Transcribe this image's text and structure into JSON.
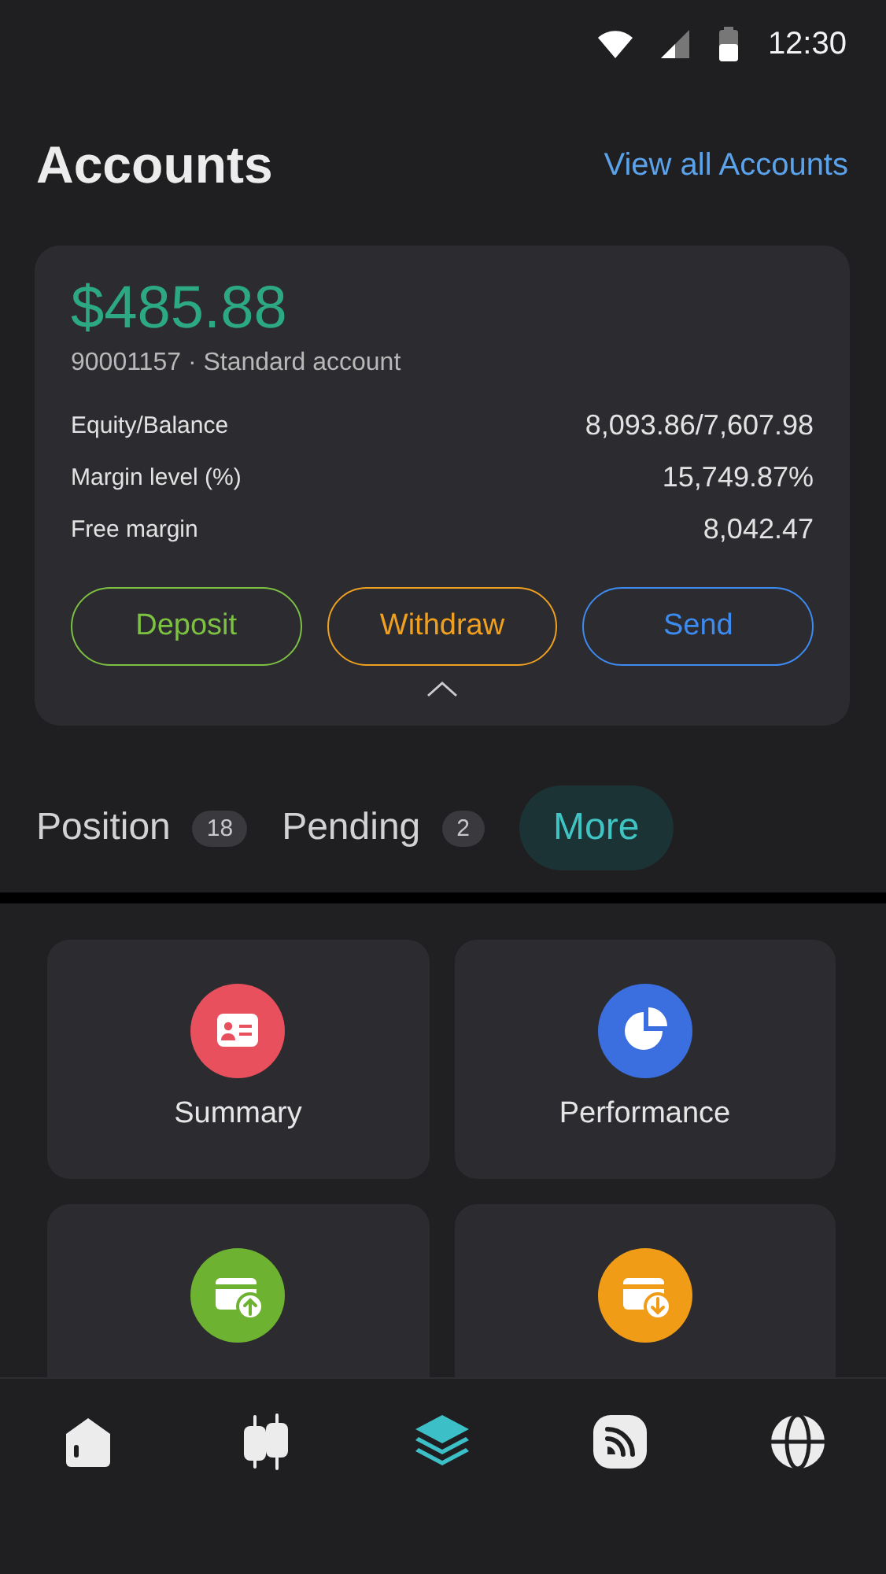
{
  "status_bar": {
    "time": "12:30"
  },
  "header": {
    "title": "Accounts",
    "link": "View all Accounts"
  },
  "account": {
    "balance": "$485.88",
    "subtitle": "90001157 · Standard account",
    "stats": [
      {
        "label": "Equity/Balance",
        "value": "8,093.86/7,607.98"
      },
      {
        "label": "Margin level (%)",
        "value": "15,749.87%"
      },
      {
        "label": "Free margin",
        "value": "8,042.47"
      }
    ],
    "buttons": [
      {
        "label": "Deposit",
        "color": "#7cc142"
      },
      {
        "label": "Withdraw",
        "color": "#f0a020"
      },
      {
        "label": "Send",
        "color": "#3d8bf0"
      }
    ]
  },
  "tabs": [
    {
      "label": "Position",
      "count": "18",
      "selected": false
    },
    {
      "label": "Pending",
      "count": "2",
      "selected": false
    },
    {
      "label": "More",
      "selected": true
    }
  ],
  "shortcuts": [
    {
      "kind": "card",
      "label": "Summary",
      "color": "#e9505e"
    },
    {
      "kind": "pie",
      "label": "Performance",
      "color": "#3b6fe0"
    },
    {
      "kind": "upload",
      "color": "#6db331"
    },
    {
      "kind": "download",
      "color": "#f09c17"
    }
  ],
  "nav": [
    {
      "kind": "home",
      "selected": false
    },
    {
      "kind": "candles",
      "selected": false
    },
    {
      "kind": "layers",
      "selected": true
    },
    {
      "kind": "feed",
      "selected": false
    },
    {
      "kind": "globe",
      "selected": false
    }
  ]
}
